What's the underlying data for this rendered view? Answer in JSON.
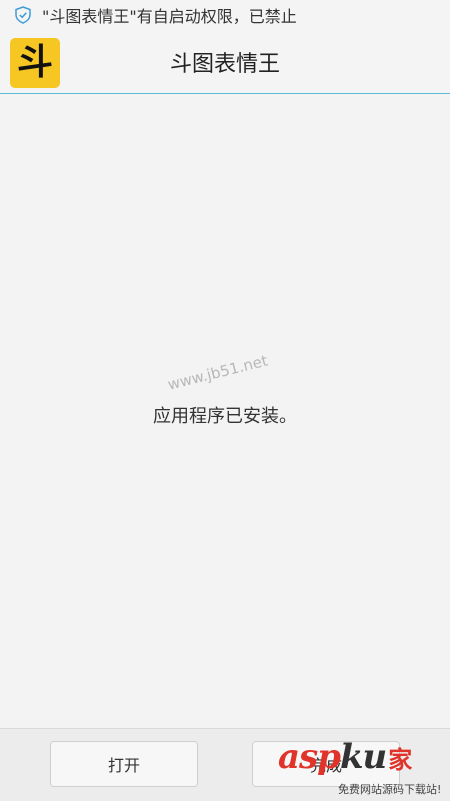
{
  "notification": {
    "icon": "shield-check-icon",
    "text": "\"斗图表情王\"有自启动权限，已禁止"
  },
  "header": {
    "app_icon_glyph": "斗",
    "app_icon_color": "#f6c623",
    "title": "斗图表情王"
  },
  "main": {
    "watermark": "www.jb51.net",
    "status_message": "应用程序已安装。"
  },
  "buttons": {
    "open_label": "打开",
    "done_label": "完成"
  },
  "watermark_logo": {
    "asp": "asp",
    "ku": "ku",
    "jia": "家",
    "subtitle": "免费网站源码下载站!"
  },
  "colors": {
    "accent_line": "#5fb9d8",
    "notif_icon": "#3a9bd6"
  }
}
